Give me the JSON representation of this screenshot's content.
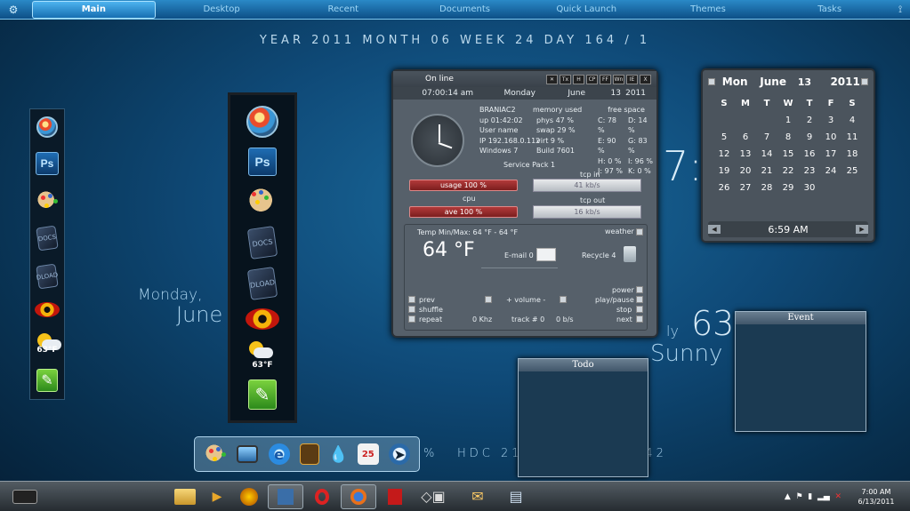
{
  "topbar": {
    "tabs": [
      {
        "label": "Main",
        "active": true
      },
      {
        "label": "Desktop",
        "active": false
      },
      {
        "label": "Recent",
        "active": false
      },
      {
        "label": "Documents",
        "active": false
      },
      {
        "label": "Quick Launch",
        "active": false
      },
      {
        "label": "Themes",
        "active": false
      },
      {
        "label": "Tasks",
        "active": false
      }
    ],
    "left_icon": "gear-icon",
    "right_icon": "pin-icon"
  },
  "dateline": "YEAR 2011   MONTH 06   WEEK 24   DAY 164 / 1",
  "left_dock": [
    "windows-orb-icon",
    "photoshop-icon",
    "palette-icon",
    "docs-folder-icon",
    "dloads-folder-icon",
    "eye-app-icon",
    "weather-icon",
    "recycle-icon"
  ],
  "dock_labels": {
    "ps": "Ps",
    "docs": "DOCS",
    "dloads": "DLOAD",
    "weather": "63°F"
  },
  "desktop_text": {
    "day": "Monday,",
    "month": "June",
    "big_seven": "7:",
    "temp": "63",
    "cond_prefix": "ly",
    "condition": "Sunny",
    "bottom_stats_left": "%",
    "hdc": "HDC 21 %",
    "net": "NET 201 /42"
  },
  "sysmon": {
    "title": "On line",
    "buttons": [
      "tools",
      "Tx",
      "H",
      "CP",
      "FF",
      "Wn",
      "IE",
      "X"
    ],
    "time": "07:00:14 am",
    "weekday": "Monday",
    "month": "June",
    "day": "13",
    "year": "2011",
    "host": "BRANIAC2",
    "uptime": "up 01:42:02",
    "user": "User name",
    "ip": "IP 192.168.0.112",
    "os": "Windows 7",
    "build": "Build 7601",
    "sp": "Service Pack 1",
    "mem_header": "memory used",
    "phys": "phys 47 %",
    "swap": "swap 29 %",
    "virt": "virt 9 %",
    "free_header": "free space",
    "drives": [
      "C: 78 %",
      "D: 14 %",
      "E: 90 %",
      "G: 83 %",
      "H: 0 %",
      "I: 96 %",
      "J: 97 %",
      "K: 0 %"
    ],
    "usage": "usage 100 %",
    "cpu_label": "cpu",
    "ave": "ave 100 %",
    "tcp_in_label": "tcp in",
    "tcp_in": "41 kb/s",
    "tcp_out_label": "tcp out",
    "tcp_out": "16 kb/s",
    "temp_minmax": "Temp Min/Max: 64 °F - 64 °F",
    "weather_label": "weather",
    "temp_now": "64 °F",
    "email": "E-mail 0",
    "recycle": "Recycle 4",
    "prev": "prev",
    "volume": "+ volume -",
    "power": "power",
    "shuffle": "shuffle",
    "playpause": "play/pause",
    "repeat": "repeat",
    "khz": "0 Khz",
    "track": "track # 0",
    "bs": "0 b/s",
    "stop": "stop",
    "next": "next"
  },
  "calendar": {
    "weekday": "Mon",
    "month": "June",
    "day": "13",
    "year": "2011",
    "headers": [
      "S",
      "M",
      "T",
      "W",
      "T",
      "F",
      "S"
    ],
    "cells": [
      "",
      "",
      "",
      "1",
      "2",
      "3",
      "4",
      "5",
      "6",
      "7",
      "8",
      "9",
      "10",
      "11",
      "12",
      "13",
      "14",
      "15",
      "16",
      "17",
      "18",
      "19",
      "20",
      "21",
      "22",
      "23",
      "24",
      "25",
      "26",
      "27",
      "28",
      "29",
      "30",
      "",
      ""
    ],
    "time": "6:59 AM"
  },
  "todo": {
    "title": "Todo"
  },
  "event": {
    "title": "Event"
  },
  "bottom_dock": [
    "palette-icon",
    "monitor-icon",
    "ie-icon",
    "notes-icon",
    "drop-icon",
    "calendar-icon",
    "cursor-icon"
  ],
  "bottom_dock_labels": {
    "cal": "25"
  },
  "taskbar": {
    "items": [
      "start-button",
      "folder-icon",
      "media-player-icon",
      "app-orb-icon",
      "dock-app-icon",
      "opera-icon",
      "firefox-icon",
      "acrobat-icon",
      "tools-icon",
      "mail-icon",
      "network-icon"
    ],
    "clock_time": "7:00 AM",
    "clock_date": "6/13/2011"
  },
  "colors": {
    "accent": "#2a89c7",
    "panel": "#56606a",
    "bar_red": "#b23a3a"
  }
}
